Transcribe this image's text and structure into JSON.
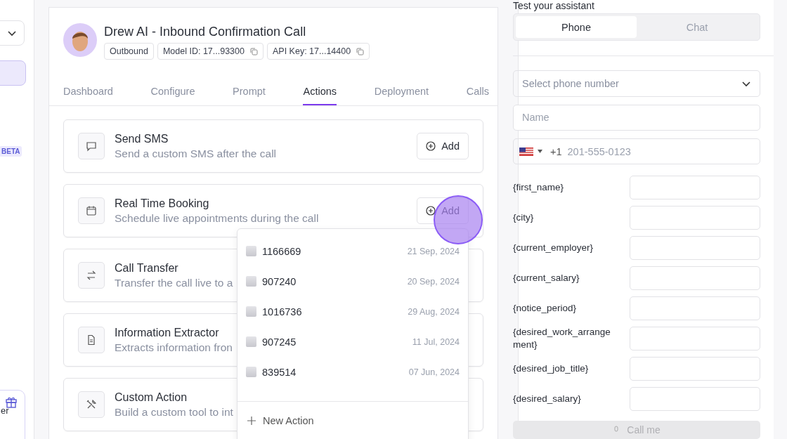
{
  "sidebar": {
    "badge": "BETA",
    "promo_fragment": "er"
  },
  "agent": {
    "title": "Drew AI - Inbound Confirmation Call",
    "tags": [
      {
        "text": "Outbound",
        "copy": false
      },
      {
        "text": "Model ID: 17...93300",
        "copy": true
      },
      {
        "text": "API Key: 17...14400",
        "copy": true
      }
    ]
  },
  "tabs": [
    {
      "label": "Dashboard",
      "selected": false
    },
    {
      "label": "Configure",
      "selected": false
    },
    {
      "label": "Prompt",
      "selected": false
    },
    {
      "label": "Actions",
      "selected": true
    },
    {
      "label": "Deployment",
      "selected": false
    },
    {
      "label": "Calls",
      "selected": false
    }
  ],
  "actions": [
    {
      "kind": "sms",
      "title": "Send SMS",
      "description": "Send a custom SMS after the call",
      "button": "Add"
    },
    {
      "kind": "calendar",
      "title": "Real Time Booking",
      "description": "Schedule live appointments during the call",
      "button": "Add"
    },
    {
      "kind": "transfer",
      "title": "Call Transfer",
      "description": "Transfer the call live to a"
    },
    {
      "kind": "document",
      "title": "Information Extractor",
      "description": "Extracts information fron"
    },
    {
      "kind": "tools",
      "title": "Custom Action",
      "description": "Build a custom tool to int"
    }
  ],
  "action_menu": {
    "items": [
      {
        "name": "1166669",
        "date": "21 Sep, 2024"
      },
      {
        "name": "907240",
        "date": "20 Sep, 2024"
      },
      {
        "name": "1016736",
        "date": "29 Aug, 2024"
      },
      {
        "name": "907245",
        "date": "11 Jul, 2024"
      },
      {
        "name": "839514",
        "date": "07 Jun, 2024"
      }
    ],
    "new_action": "New Action"
  },
  "test_panel": {
    "title": "Test your assistant",
    "modes": [
      {
        "label": "Phone",
        "selected": true
      },
      {
        "label": "Chat",
        "selected": false
      }
    ],
    "phone_select": {
      "placeholder": "Select phone number"
    },
    "name_field": {
      "placeholder": "Name"
    },
    "phone_field": {
      "country_code": "+1",
      "placeholder": "201-555-0123"
    },
    "variables": [
      "{first_name}",
      "{city}",
      "{current_employer}",
      "{current_salary}",
      "{notice_period}",
      "{desired_work_arrangement}",
      "{desired_job_title}",
      "{desired_salary}"
    ],
    "call_button": "Call me"
  }
}
